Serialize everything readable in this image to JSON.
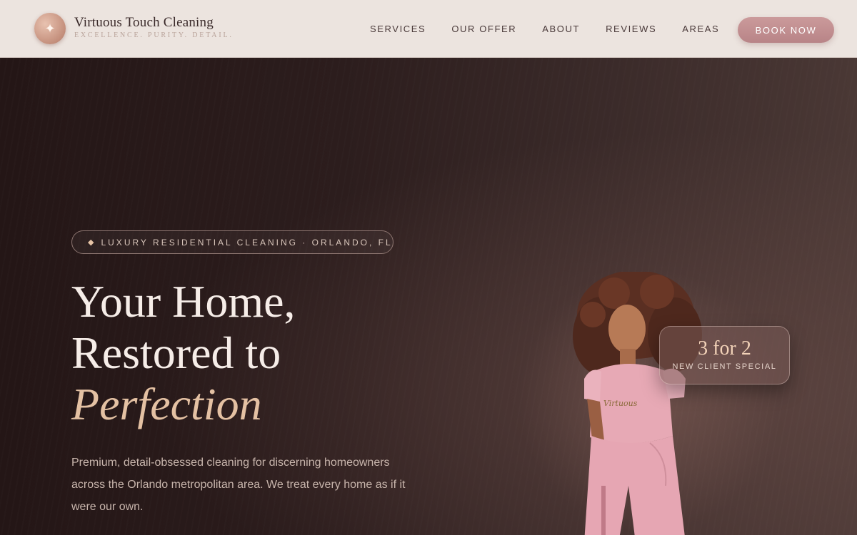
{
  "brand": {
    "name": "Virtuous Touch Cleaning",
    "tagline": "EXCELLENCE. PURITY. DETAIL.",
    "logo_icon": "sparkle-icon"
  },
  "nav": {
    "items": [
      "SERVICES",
      "OUR OFFER",
      "ABOUT",
      "REVIEWS",
      "AREAS"
    ],
    "cta": "BOOK NOW"
  },
  "hero": {
    "badge_icon": "diamond-icon",
    "badge": "LUXURY RESIDENTIAL CLEANING · ORLANDO, FL",
    "title_line1": "Your Home,",
    "title_line2": "Restored to",
    "title_accent": "Perfection",
    "lead": "Premium, detail-obsessed cleaning for discerning homeowners across the Orlando metropolitan area. We treat every home as if it were our own."
  },
  "offer": {
    "title": "3 for 2",
    "subtitle": "NEW CLIENT SPECIAL"
  },
  "colors": {
    "accent": "#c48f7c",
    "cta": "#b88487",
    "heading_accent": "#e4c1a3"
  }
}
